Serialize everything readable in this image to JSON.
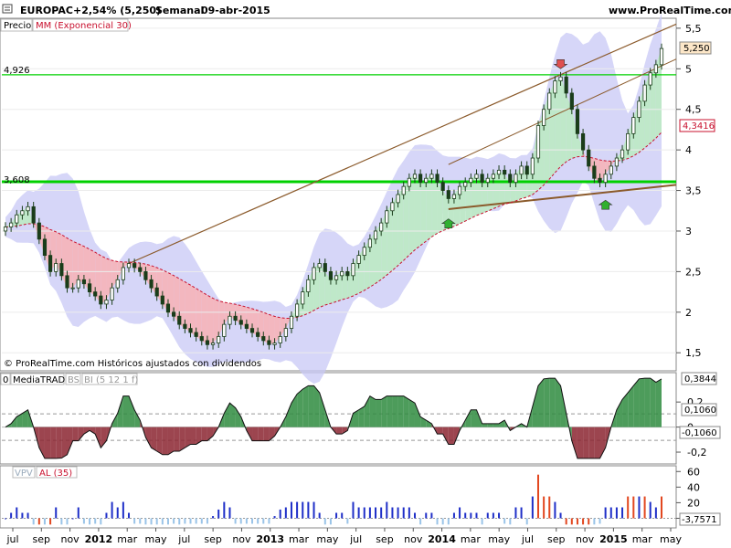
{
  "header": {
    "symbol": "EUROPAC",
    "change": "+2,54% (5,250)",
    "period": "Semanal",
    "date": "09-abr-2015",
    "site": "www.ProRealTime.com"
  },
  "price_panel": {
    "label_price": "Precio",
    "label_ma": "MM (Exponencial 30)",
    "copyright": "© ProRealTime.com Históricos ajustados con dividendos",
    "last_price_label": "5,250",
    "ma_value_label": "4,3416",
    "hline_high_label": "4,926",
    "hline_low_label": "3,608"
  },
  "indicator_panel": {
    "label_a": "0",
    "label_b": "MediaTRAD",
    "label_c": "BS",
    "label_d": "BI (5 12 1 f)",
    "value_label": "0,3844",
    "level_up_label": "0,1060",
    "level_dn_label": "-0,1060"
  },
  "volume_panel": {
    "label_a": "VPV",
    "label_b": "AL (35)",
    "value_label": "-3,7571"
  },
  "colors": {
    "price_line": "#2d7c2d",
    "band_fill": "#c8c8f5",
    "uptrend_fill": "#bfe8c9",
    "downtrend_fill": "#f3b7bf",
    "ma_line": "#c8102e",
    "trendline": "#8b5a2b",
    "hline": "#00d000"
  },
  "chart_data": [
    {
      "type": "candlestick",
      "title": "EUROPAC +2,54% (5,250) Semanal 09-abr-2015",
      "period": "weekly",
      "y_ticks": [
        1.5,
        2,
        2.5,
        3,
        3.5,
        4,
        4.5,
        5,
        5.5
      ],
      "y_tick_labels": [
        "1,5",
        "2",
        "2,5",
        "3",
        "3,5",
        "4",
        "4,5",
        "5",
        "5,5"
      ],
      "ylim": [
        1.3,
        5.6
      ],
      "x_tick_labels": [
        "jul",
        "sep",
        "nov",
        "2012",
        "mar",
        "may",
        "jul",
        "sep",
        "nov",
        "2013",
        "mar",
        "may",
        "jul",
        "sep",
        "nov",
        "2014",
        "mar",
        "may",
        "jul",
        "sep",
        "nov",
        "2015",
        "mar",
        "may"
      ],
      "x_tick_bold": [
        "2012",
        "2013",
        "2014",
        "2015"
      ],
      "x_range_months": [
        "2011-07",
        "2015-05"
      ],
      "close_series": [
        3.05,
        3.1,
        3.2,
        3.25,
        3.3,
        3.1,
        2.9,
        2.7,
        2.5,
        2.6,
        2.45,
        2.3,
        2.3,
        2.4,
        2.35,
        2.25,
        2.2,
        2.1,
        2.15,
        2.3,
        2.4,
        2.55,
        2.6,
        2.55,
        2.5,
        2.4,
        2.3,
        2.2,
        2.1,
        2.0,
        1.95,
        1.85,
        1.8,
        1.75,
        1.7,
        1.65,
        1.6,
        1.62,
        1.7,
        1.85,
        1.95,
        1.9,
        1.85,
        1.8,
        1.75,
        1.7,
        1.65,
        1.6,
        1.62,
        1.7,
        1.8,
        1.95,
        2.1,
        2.25,
        2.4,
        2.55,
        2.6,
        2.5,
        2.4,
        2.45,
        2.5,
        2.45,
        2.6,
        2.7,
        2.8,
        2.9,
        3.0,
        3.1,
        3.25,
        3.35,
        3.45,
        3.55,
        3.65,
        3.7,
        3.6,
        3.65,
        3.7,
        3.6,
        3.5,
        3.4,
        3.45,
        3.55,
        3.6,
        3.65,
        3.7,
        3.6,
        3.65,
        3.7,
        3.75,
        3.7,
        3.6,
        3.7,
        3.8,
        3.7,
        3.9,
        4.3,
        4.5,
        4.7,
        4.85,
        4.9,
        4.7,
        4.5,
        4.2,
        4.0,
        3.8,
        3.65,
        3.6,
        3.7,
        3.8,
        3.9,
        4.0,
        4.2,
        4.4,
        4.6,
        4.8,
        4.95,
        5.05,
        5.25
      ],
      "moving_average": {
        "type": "exponential",
        "length": 30,
        "last_value": 4.3416
      },
      "horizontal_lines": [
        4.926,
        3.608
      ],
      "annotations": [
        "down-arrow near 2014-sep high",
        "up-arrow near 2014-ene low",
        "up-arrow near 2015-ene low"
      ]
    },
    {
      "type": "area",
      "title": "MediaTRAD BI (5 12 1 f)",
      "y_ticks": [
        0.2,
        0,
        -0.2
      ],
      "y_tick_labels": [
        "0,2",
        "0",
        "-0,2"
      ],
      "ylim": [
        -0.28,
        0.42
      ],
      "levels": [
        0.106,
        -0.106
      ],
      "last_value": 0.3844
    },
    {
      "type": "bar",
      "title": "VPV AL (35)",
      "y_ticks": [
        60,
        40,
        20,
        0
      ],
      "y_tick_labels": [
        "60",
        "40",
        "20",
        "0"
      ],
      "ylim": [
        -10,
        65
      ],
      "last_value": -3.7571
    }
  ]
}
